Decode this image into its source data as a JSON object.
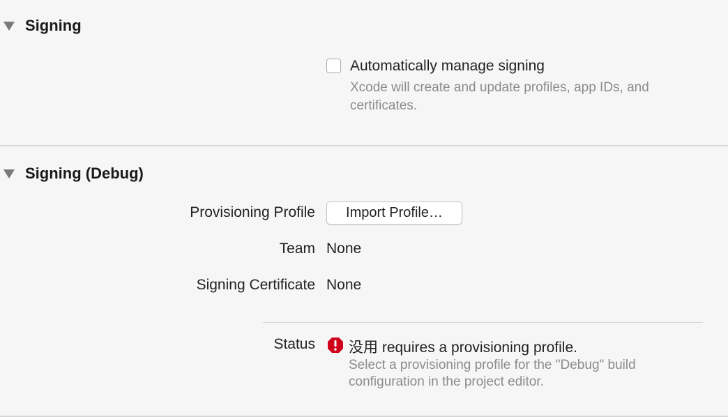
{
  "signing": {
    "title": "Signing",
    "auto_manage_label": "Automatically manage signing",
    "auto_manage_checked": false,
    "auto_manage_desc_line1": "Xcode will create and update profiles, app IDs, and",
    "auto_manage_desc_line2": "certificates."
  },
  "signing_debug": {
    "title": "Signing (Debug)",
    "provisioning_profile_label": "Provisioning Profile",
    "import_profile_button": "Import Profile…",
    "team_label": "Team",
    "team_value": "None",
    "signing_certificate_label": "Signing Certificate",
    "signing_certificate_value": "None",
    "status_label": "Status",
    "status_message": "没用 requires a provisioning profile.",
    "status_detail_line1": "Select a provisioning profile for the \"Debug\" build",
    "status_detail_line2": "configuration in the project editor."
  },
  "icons": {
    "disclosure": "disclosure-triangle-icon",
    "error": "error-icon"
  },
  "colors": {
    "error_red": "#d0021b",
    "secondary_text": "#8b8b8b",
    "background": "#f6f6f6"
  }
}
